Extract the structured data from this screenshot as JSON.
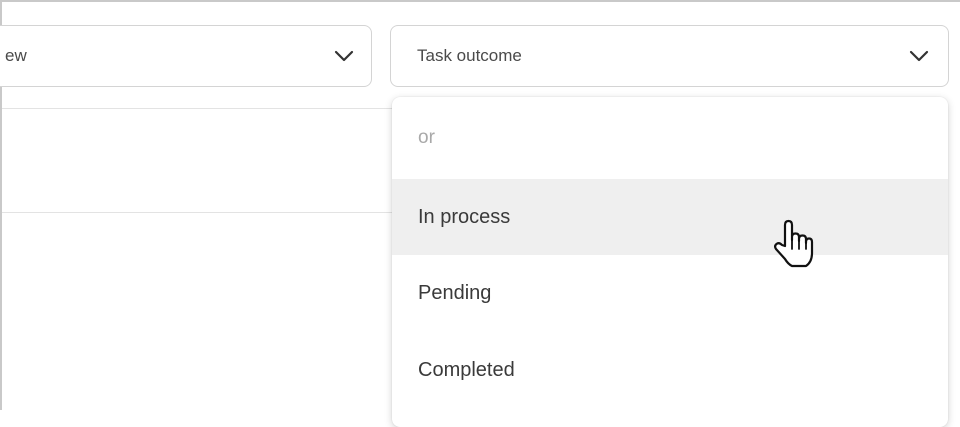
{
  "filters": {
    "left_select": {
      "value": "ew"
    },
    "task_outcome_select": {
      "value": "Task outcome"
    }
  },
  "dropdown": {
    "items": [
      {
        "label": "or",
        "state": "placeholder"
      },
      {
        "label": "In process",
        "state": "hovered"
      },
      {
        "label": "Pending",
        "state": "normal"
      },
      {
        "label": "Completed",
        "state": "normal"
      }
    ]
  },
  "icons": {
    "chevron": "chevron-down-icon",
    "cursor": "hand-pointer-cursor-icon"
  },
  "colors": {
    "hover_background": "#efefef",
    "placeholder_text": "#a9a9a9",
    "border": "#d4d4d4"
  }
}
